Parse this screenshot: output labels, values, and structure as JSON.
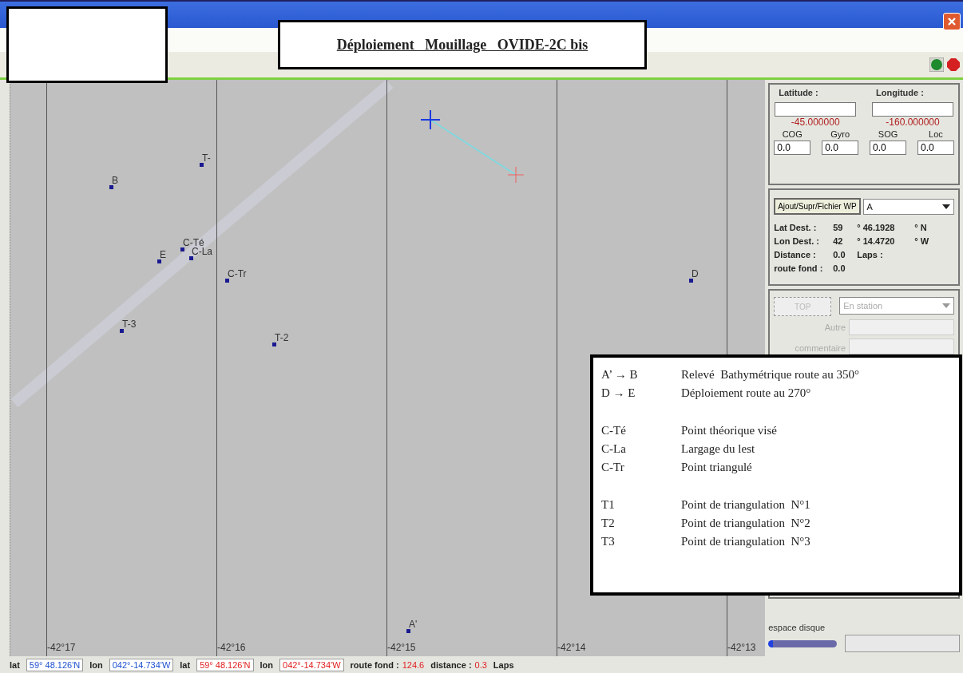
{
  "window": {
    "title": "Déploiement   Mouillage   OVIDE-2C bis"
  },
  "map": {
    "grid_labels": [
      "-42°17",
      "-42°16",
      "-42°15",
      "-42°14",
      "-42°13"
    ],
    "points": [
      {
        "label": "T-"
      },
      {
        "label": "B"
      },
      {
        "label": "C-Té"
      },
      {
        "label": "E"
      },
      {
        "label": "C-La"
      },
      {
        "label": "C-Tr"
      },
      {
        "label": "D"
      },
      {
        "label": "T-3"
      },
      {
        "label": "T-2"
      },
      {
        "label": "A'"
      }
    ]
  },
  "panel": {
    "position": {
      "lat_label": "Latitude :",
      "lon_label": "Longitude :",
      "lat_value": "-45.000000",
      "lon_value": "-160.000000",
      "readings": [
        {
          "label": "COG",
          "value": "0.0"
        },
        {
          "label": "Gyro",
          "value": "0.0"
        },
        {
          "label": "SOG",
          "value": "0.0"
        },
        {
          "label": "Loc",
          "value": "0.0"
        }
      ]
    },
    "waypoint": {
      "button": "Ajout/Supr/Fichier WP",
      "selected_wp": "A",
      "rows": [
        [
          "Lat Dest. :",
          "59",
          "° 46.1928",
          "° N"
        ],
        [
          "Lon Dest. :",
          "42",
          "° 14.4720",
          "° W"
        ],
        [
          "Distance :",
          "0.0",
          "Laps :"
        ],
        [
          "route fond :",
          "0.0"
        ]
      ]
    },
    "station": {
      "button": "TOP",
      "mode": "En station",
      "disabled": true,
      "other_label": "Autre",
      "comment_label": "commentaire"
    },
    "disk": {
      "label": "espace disque"
    }
  },
  "legend": [
    [
      {
        "code": "A’ → B",
        "text": "Relevé  Bathymétrique route au 350°"
      },
      {
        "code": "D → E",
        "text": "Déploiement route au 270°"
      }
    ],
    [
      {
        "code": "C-Té",
        "text": "Point théorique visé"
      },
      {
        "code": "C-La",
        "text": "Largage du lest"
      },
      {
        "code": "C-Tr",
        "text": "Point triangulé"
      }
    ],
    [
      {
        "code": "T1",
        "text": "Point de triangulation  N°1"
      },
      {
        "code": "T2",
        "text": "Point de triangulation  N°2"
      },
      {
        "code": "T3",
        "text": "Point de triangulation  N°3"
      }
    ]
  ],
  "status_bar": [
    {
      "kind": "label",
      "text": "lat"
    },
    {
      "kind": "value",
      "text": "59° 48.126'N",
      "color": "#1e50d0"
    },
    {
      "kind": "label",
      "text": "lon"
    },
    {
      "kind": "value",
      "text": "042°-14.734'W",
      "color": "#1e50d0"
    },
    {
      "kind": "label",
      "text": "lat"
    },
    {
      "kind": "value",
      "text": "59° 48.126'N",
      "color": "#e02020"
    },
    {
      "kind": "label",
      "text": "lon"
    },
    {
      "kind": "value",
      "text": "042°-14.734'W",
      "color": "#e02020"
    },
    {
      "kind": "label",
      "text": "route fond :"
    },
    {
      "kind": "reading",
      "text": "124.6",
      "color": "#e02020"
    },
    {
      "kind": "label",
      "text": "distance :"
    },
    {
      "kind": "reading",
      "text": "0.3",
      "color": "#e02020"
    },
    {
      "kind": "label",
      "text": "Laps"
    }
  ]
}
